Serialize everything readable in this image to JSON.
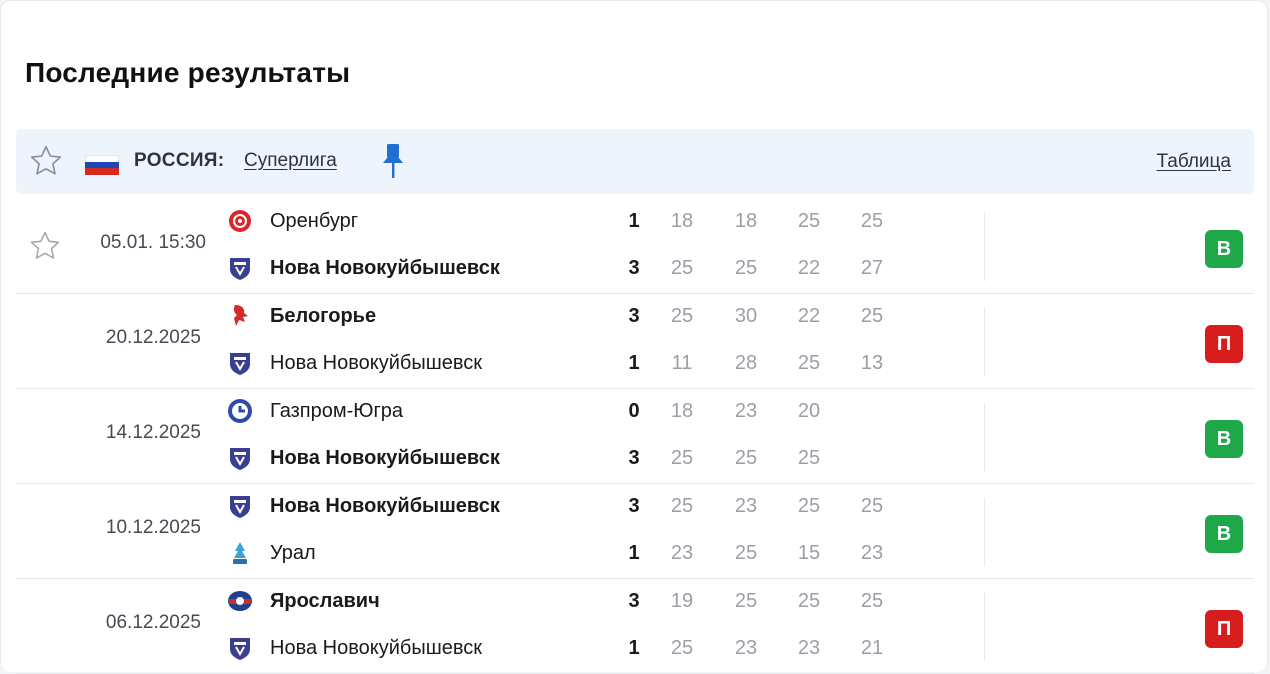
{
  "section": {
    "title": "Последние результаты"
  },
  "league": {
    "country": "РОССИЯ:",
    "name": "Суперлига",
    "table_link": "Таблица"
  },
  "colors": {
    "win": "#1fa84a",
    "loss": "#d61c1c",
    "accent": "#1f6fd0"
  },
  "matches": [
    {
      "date": "05.01. 15:30",
      "home": {
        "name": "Оренбург",
        "score": "1",
        "sets": [
          "18",
          "18",
          "25",
          "25"
        ],
        "winner": false,
        "logo": "orenburg-logo"
      },
      "away": {
        "name": "Нова Новокуйбышевск",
        "score": "3",
        "sets": [
          "25",
          "25",
          "22",
          "27"
        ],
        "winner": true,
        "logo": "nova-logo"
      },
      "result": "В"
    },
    {
      "date": "20.12.2025",
      "home": {
        "name": "Белогорье",
        "score": "3",
        "sets": [
          "25",
          "30",
          "22",
          "25"
        ],
        "winner": true,
        "logo": "belogorie-logo"
      },
      "away": {
        "name": "Нова Новокуйбышевск",
        "score": "1",
        "sets": [
          "11",
          "28",
          "25",
          "13"
        ],
        "winner": false,
        "logo": "nova-logo"
      },
      "result": "П"
    },
    {
      "date": "14.12.2025",
      "home": {
        "name": "Газпром-Югра",
        "score": "0",
        "sets": [
          "18",
          "23",
          "20"
        ],
        "winner": false,
        "logo": "gazprom-logo"
      },
      "away": {
        "name": "Нова Новокуйбышевск",
        "score": "3",
        "sets": [
          "25",
          "25",
          "25"
        ],
        "winner": true,
        "logo": "nova-logo"
      },
      "result": "В"
    },
    {
      "date": "10.12.2025",
      "home": {
        "name": "Нова Новокуйбышевск",
        "score": "3",
        "sets": [
          "25",
          "23",
          "25",
          "25"
        ],
        "winner": true,
        "logo": "nova-logo"
      },
      "away": {
        "name": "Урал",
        "score": "1",
        "sets": [
          "23",
          "25",
          "15",
          "23"
        ],
        "winner": false,
        "logo": "ural-logo"
      },
      "result": "В"
    },
    {
      "date": "06.12.2025",
      "home": {
        "name": "Ярославич",
        "score": "3",
        "sets": [
          "19",
          "25",
          "25",
          "25"
        ],
        "winner": true,
        "logo": "yaroslavich-logo"
      },
      "away": {
        "name": "Нова Новокуйбышевск",
        "score": "1",
        "sets": [
          "25",
          "23",
          "23",
          "21"
        ],
        "winner": false,
        "logo": "nova-logo"
      },
      "result": "П"
    }
  ]
}
